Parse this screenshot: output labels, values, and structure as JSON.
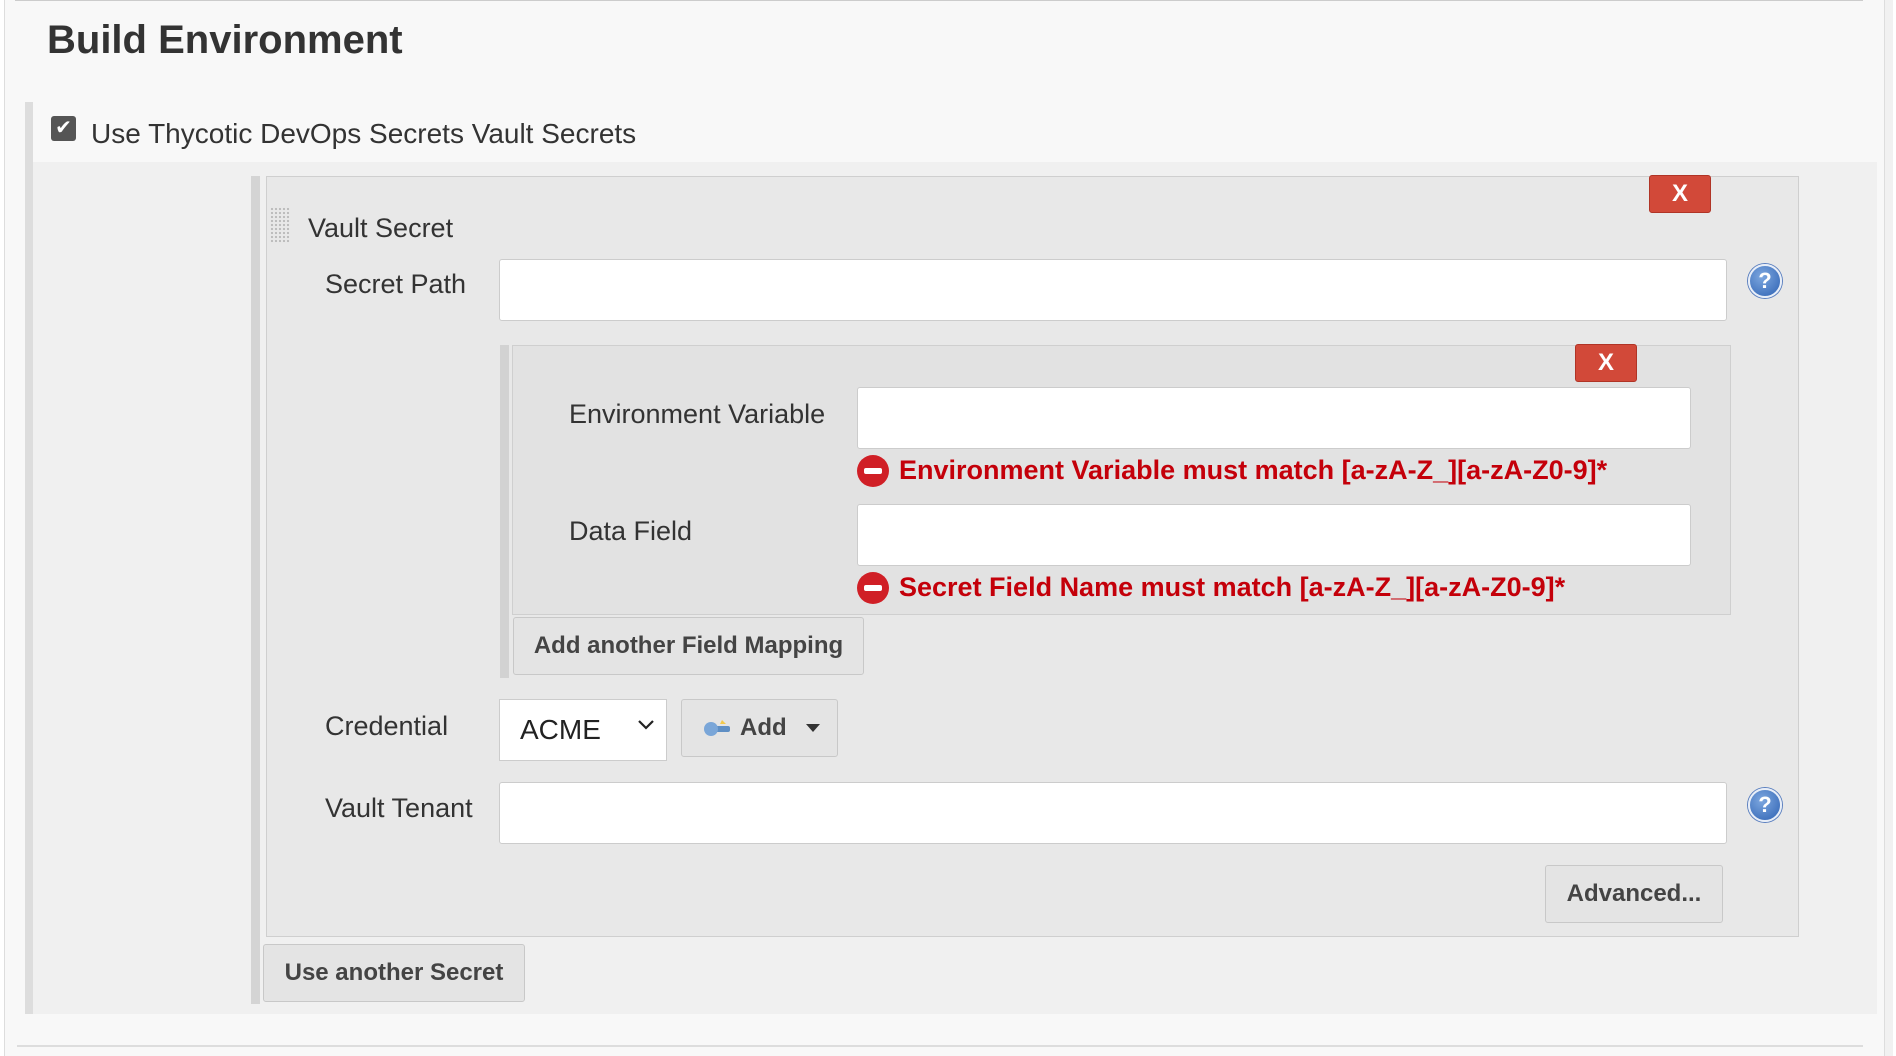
{
  "section": {
    "title": "Build Environment"
  },
  "vault_option": {
    "checked": true,
    "label": "Use Thycotic DevOps Secrets Vault Secrets"
  },
  "vault_secret": {
    "title": "Vault Secret",
    "delete_label": "X",
    "secret_path": {
      "label": "Secret Path",
      "value": ""
    },
    "field_mapping": {
      "delete_label": "X",
      "environment_variable": {
        "label": "Environment Variable",
        "value": "",
        "error": "Environment Variable must match [a-zA-Z_][a-zA-Z0-9]*"
      },
      "data_field": {
        "label": "Data Field",
        "value": "",
        "error": "Secret Field Name must match [a-zA-Z_][a-zA-Z0-9]*"
      },
      "add_button": "Add another Field Mapping"
    },
    "credential": {
      "label": "Credential",
      "selected": "ACME",
      "add_button": "Add"
    },
    "vault_tenant": {
      "label": "Vault Tenant",
      "value": ""
    },
    "advanced_button": "Advanced..."
  },
  "add_secret_button": "Use another Secret",
  "help_icon_glyph": "?",
  "colors": {
    "delete": "#d24939",
    "error": "#c4000a",
    "help": "#2e62b3"
  }
}
